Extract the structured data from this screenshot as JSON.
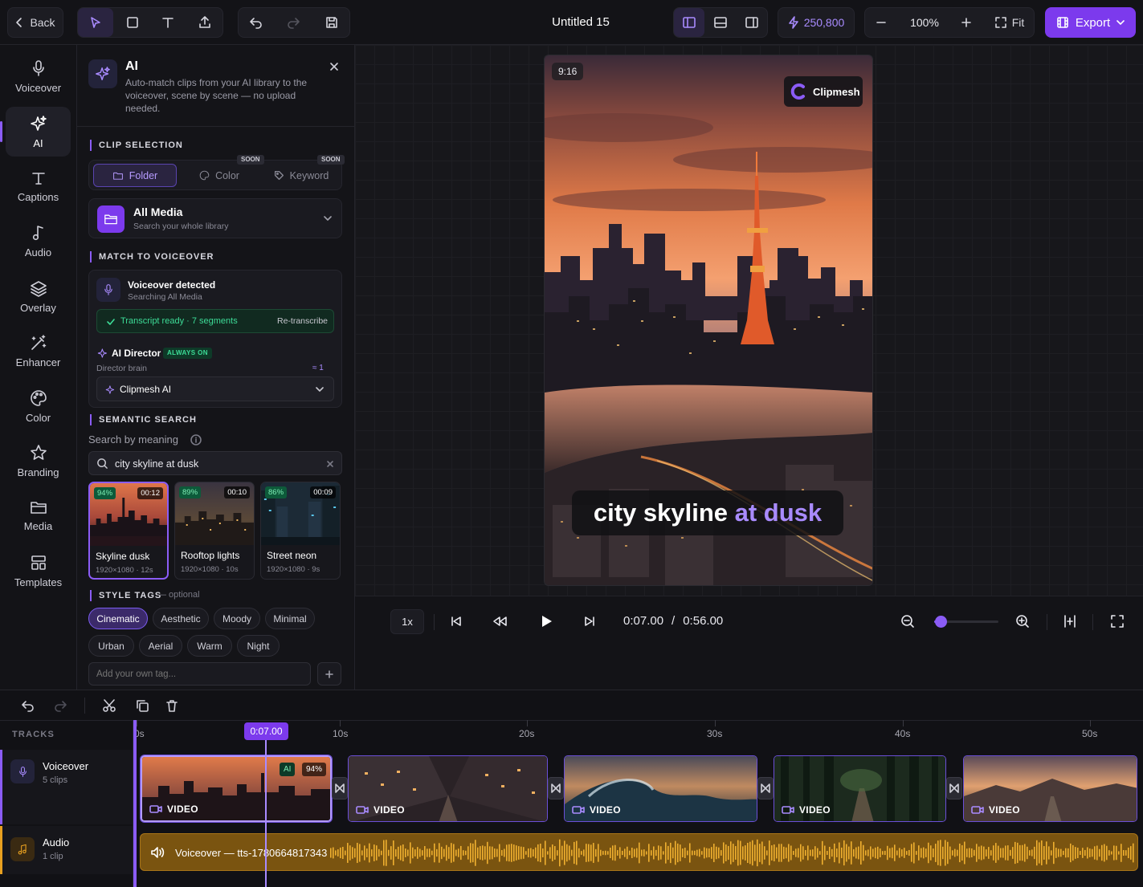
{
  "topbar": {
    "back_label": "Back",
    "title": "Untitled 15",
    "credits": "250,800",
    "zoom": "100%",
    "fit_label": "Fit",
    "export_label": "Export"
  },
  "rail": [
    {
      "label": "Voiceover",
      "icon": "mic-icon"
    },
    {
      "label": "AI",
      "icon": "sparkles-icon"
    },
    {
      "label": "Captions",
      "icon": "text-icon"
    },
    {
      "label": "Audio",
      "icon": "music-note-icon"
    },
    {
      "label": "Overlay",
      "icon": "layers-icon"
    },
    {
      "label": "Enhancer",
      "icon": "magic-wand-icon"
    },
    {
      "label": "Color",
      "icon": "palette-icon"
    },
    {
      "label": "Branding",
      "icon": "star-icon"
    },
    {
      "label": "Media",
      "icon": "folder-icon"
    },
    {
      "label": "Templates",
      "icon": "templates-icon"
    }
  ],
  "panel": {
    "title": "AI",
    "description": "Auto-match clips from your AI library to the voiceover, scene by scene — no upload needed.",
    "clip_selection": {
      "title": "CLIP SELECTION",
      "tabs": [
        {
          "label": "Folder",
          "badge": ""
        },
        {
          "label": "Color",
          "badge": "SOON"
        },
        {
          "label": "Keyword",
          "badge": "SOON"
        }
      ],
      "source_title": "All Media",
      "source_sub": "Search your whole library"
    },
    "match": {
      "title": "MATCH TO VOICEOVER",
      "detected": "Voiceover detected",
      "detected_sub": "Searching All Media",
      "transcript": "Transcript ready · 7 segments",
      "retranscribe": "Re-transcribe",
      "director": "AI Director",
      "director_badge": "ALWAYS ON",
      "brain_label": "Director brain",
      "brain_meta": "≈ 1",
      "brain_value": "Clipmesh AI"
    },
    "semantic": {
      "title": "SEMANTIC SEARCH",
      "label": "Search by meaning",
      "query": "city skyline at dusk",
      "results": [
        {
          "pct": "94%",
          "dur": "00:12",
          "name": "Skyline dusk",
          "meta": "1920×1080 · 12s"
        },
        {
          "pct": "89%",
          "dur": "00:10",
          "name": "Rooftop lights",
          "meta": "1920×1080 · 10s"
        },
        {
          "pct": "86%",
          "dur": "00:09",
          "name": "Street neon",
          "meta": "1920×1080 · 9s"
        }
      ]
    },
    "style": {
      "title": "STYLE TAGS",
      "optional": "— optional",
      "tags": [
        "Cinematic",
        "Aesthetic",
        "Moody",
        "Minimal",
        "Urban",
        "Aerial",
        "Warm",
        "Night"
      ],
      "add_placeholder": "Add your own tag..."
    }
  },
  "preview": {
    "ratio": "9:16",
    "brand": "Clipmesh",
    "caption_white": "city skyline ",
    "caption_accent": "at dusk"
  },
  "playbar": {
    "speed": "1x",
    "current": "0:07.00",
    "sep": "/",
    "total": "0:56.00",
    "zoom_level": 0.1
  },
  "timeline": {
    "tracks_label": "TRACKS",
    "playhead": "0:07.00",
    "ticks": [
      "0s",
      "10s",
      "20s",
      "30s",
      "40s",
      "50s"
    ],
    "voiceover_track": {
      "name": "Voiceover",
      "meta": "5 clips"
    },
    "audio_track": {
      "name": "Audio",
      "meta": "1 clip"
    },
    "clip_label": "VIDEO",
    "ai_badge": "AI",
    "ai_pct": "94%",
    "audio_clip": "Voiceover — tts-1780664817343"
  },
  "colors": {
    "accent": "#8b5cf6",
    "audio": "#e8a020",
    "success": "#3ddc97"
  }
}
